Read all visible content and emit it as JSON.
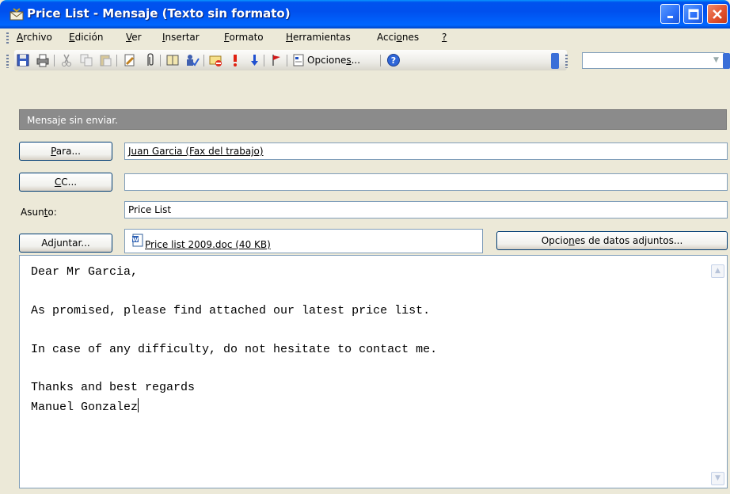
{
  "window": {
    "title": "Price List - Mensaje (Texto sin formato)",
    "icons": [
      "envelope-icon",
      "minimize-icon",
      "maximize-icon",
      "close-icon"
    ]
  },
  "menu": {
    "items": [
      {
        "label": "Archivo",
        "accel": "A",
        "rest": "rchivo"
      },
      {
        "label": "Edición",
        "accel": "E",
        "rest": "dición"
      },
      {
        "label": "Ver",
        "accel": "V",
        "rest": "er"
      },
      {
        "label": "Insertar",
        "accel": "I",
        "rest": "nsertar"
      },
      {
        "label": "Formato",
        "accel": "F",
        "rest": "ormato"
      },
      {
        "label": "Herramientas",
        "accel": "H",
        "rest": "erramientas"
      },
      {
        "label": "Acciones",
        "pre": "Acci",
        "accel": "o",
        "rest": "nes"
      },
      {
        "label": "?",
        "accel": "?",
        "rest": ""
      }
    ]
  },
  "toolbar": {
    "opciones_pre": "Opcione",
    "opciones_accel": "s",
    "opciones_post": "...",
    "icons": [
      "save-icon",
      "print-icon",
      "cut-icon",
      "copy-icon",
      "paste-icon",
      "insert-file-icon",
      "attach-icon",
      "address-book-icon",
      "check-names-icon",
      "permission-icon",
      "high-importance-icon",
      "low-importance-icon",
      "flag-icon",
      "options-icon",
      "help-icon"
    ]
  },
  "infobar": {
    "text": "Mensaje sin enviar."
  },
  "header": {
    "to_button": {
      "accel": "P",
      "rest": "ara..."
    },
    "to_value": "Juan Garcia (Fax del trabajo)",
    "cc_button": {
      "accel": "C",
      "rest": "C..."
    },
    "cc_value": "",
    "subject_label": {
      "pre": "Asun",
      "accel": "t",
      "rest": "o:"
    },
    "subject_value": "Price List",
    "attach_button": "Adjuntar...",
    "attachment": "Price list 2009.doc (40 KB)",
    "attach_options_button": {
      "pre": "Opcio",
      "accel": "n",
      "rest": "es de datos adjuntos..."
    }
  },
  "body": {
    "lines": [
      "Dear Mr Garcia,",
      "",
      "As promised, please find attached our latest price list.",
      "",
      "In case of any difficulty, do not hesitate to contact me.",
      "",
      "Thanks and best regards",
      "Manuel Gonzalez"
    ]
  }
}
